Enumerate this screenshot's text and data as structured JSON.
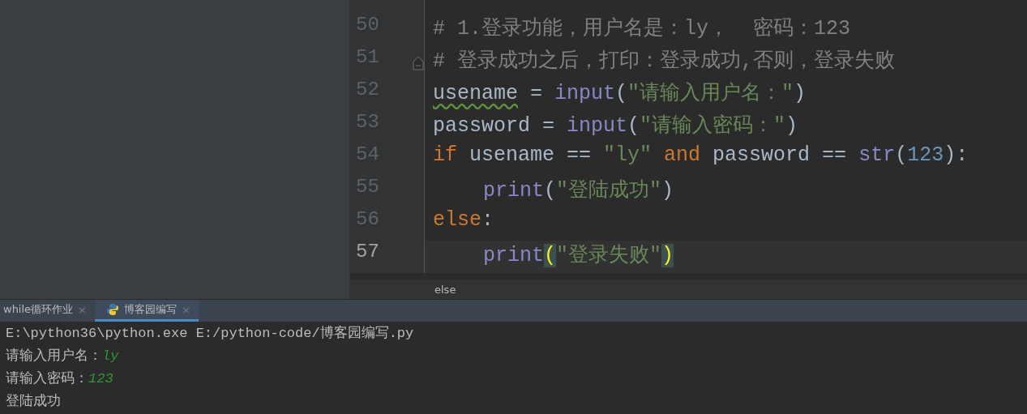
{
  "editor": {
    "lines": [
      {
        "number": "50",
        "current": false,
        "fold": false,
        "tokens": [
          {
            "text": "# 1.登录功能，用户名是：ly，  密码：123",
            "kind": "comment"
          }
        ]
      },
      {
        "number": "51",
        "current": false,
        "fold": true,
        "tokens": [
          {
            "text": "# 登录成功之后，打印：登录成功,否则，登录失败",
            "kind": "comment"
          }
        ]
      },
      {
        "number": "52",
        "current": false,
        "fold": false,
        "tokens": [
          {
            "text": "usename",
            "kind": "typo"
          },
          {
            "text": " = ",
            "kind": "plain"
          },
          {
            "text": "input",
            "kind": "builtin"
          },
          {
            "text": "(",
            "kind": "plain"
          },
          {
            "text": "\"请输入用户名：\"",
            "kind": "string"
          },
          {
            "text": ")",
            "kind": "plain"
          }
        ]
      },
      {
        "number": "53",
        "current": false,
        "fold": false,
        "tokens": [
          {
            "text": "password = ",
            "kind": "plain"
          },
          {
            "text": "input",
            "kind": "builtin"
          },
          {
            "text": "(",
            "kind": "plain"
          },
          {
            "text": "\"请输入密码：\"",
            "kind": "string"
          },
          {
            "text": ")",
            "kind": "plain"
          }
        ]
      },
      {
        "number": "54",
        "current": false,
        "fold": false,
        "tokens": [
          {
            "text": "if",
            "kind": "keyword"
          },
          {
            "text": " usename == ",
            "kind": "plain"
          },
          {
            "text": "\"ly\"",
            "kind": "string"
          },
          {
            "text": " and",
            "kind": "keyword"
          },
          {
            "text": " password == ",
            "kind": "plain"
          },
          {
            "text": "str",
            "kind": "builtin"
          },
          {
            "text": "(",
            "kind": "plain"
          },
          {
            "text": "123",
            "kind": "number"
          },
          {
            "text": "):",
            "kind": "plain"
          }
        ]
      },
      {
        "number": "55",
        "current": false,
        "fold": false,
        "indented": true,
        "tokens": [
          {
            "text": "print",
            "kind": "builtin"
          },
          {
            "text": "(",
            "kind": "plain"
          },
          {
            "text": "\"登陆成功\"",
            "kind": "string"
          },
          {
            "text": ")",
            "kind": "plain"
          }
        ]
      },
      {
        "number": "56",
        "current": false,
        "fold": false,
        "tokens": [
          {
            "text": "else",
            "kind": "keyword"
          },
          {
            "text": ":",
            "kind": "plain"
          }
        ]
      },
      {
        "number": "57",
        "current": true,
        "fold": false,
        "indented": true,
        "tokens": [
          {
            "text": "print",
            "kind": "builtin"
          },
          {
            "text": "(",
            "kind": "match"
          },
          {
            "text": "\"登录失败\"",
            "kind": "string"
          },
          {
            "text": ")",
            "kind": "match"
          }
        ]
      }
    ],
    "breadcrumb": "else"
  },
  "run_tabs": [
    {
      "label": "while循环作业",
      "selected": false,
      "python_icon": false,
      "close": "×"
    },
    {
      "label": "博客园编写",
      "selected": true,
      "python_icon": true,
      "close": "×"
    }
  ],
  "console": [
    [
      {
        "text": "E:\\python36\\python.exe E:/python-code/博客园编写.py",
        "kind": "command"
      }
    ],
    [
      {
        "text": "请输入用户名：",
        "kind": "output"
      },
      {
        "text": "ly",
        "kind": "input"
      }
    ],
    [
      {
        "text": "请输入密码：",
        "kind": "output"
      },
      {
        "text": "123",
        "kind": "input"
      }
    ],
    [
      {
        "text": "登陆成功",
        "kind": "output"
      }
    ]
  ]
}
